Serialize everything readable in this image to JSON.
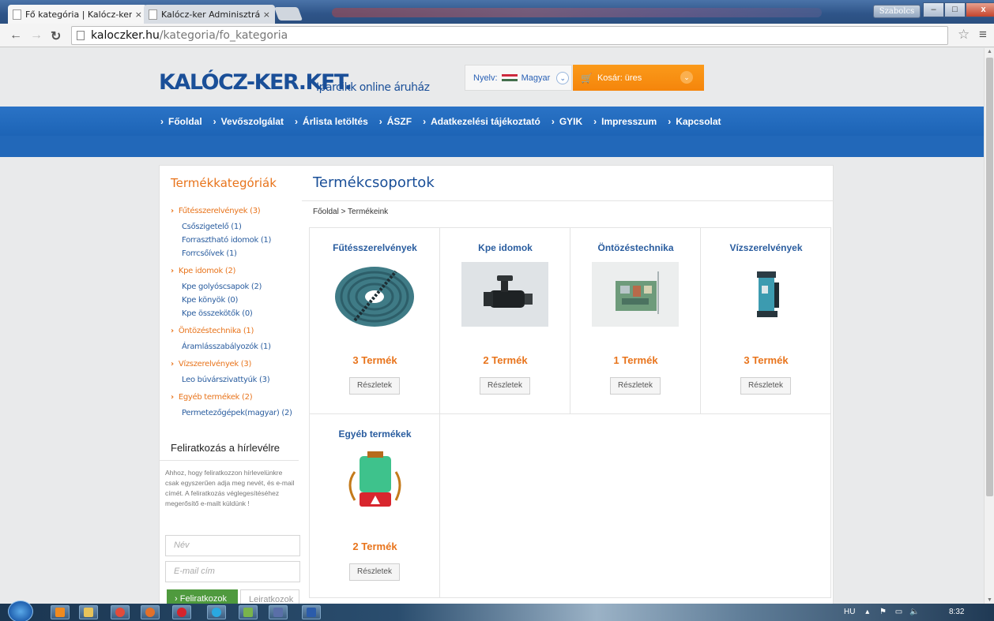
{
  "browser": {
    "tabs": [
      {
        "label": "Fő kategória | Kalócz-ker",
        "close": "×"
      },
      {
        "label": "Kalócz-ker Adminisztráció",
        "close": "×"
      }
    ],
    "user": "Szabolcs",
    "window_buttons": {
      "minimize": "–",
      "maximize": "□",
      "close": "x"
    },
    "url_host": "kaloczker.hu",
    "url_path": "/kategoria/fo_kategoria"
  },
  "header": {
    "logo": "KALÓCZ-KER.KFT.",
    "tagline": "Iparcikk online áruház",
    "language_label": "Nyelv:",
    "language_value": "Magyar",
    "cart_label": "Kosár: üres"
  },
  "nav": {
    "items": [
      "Főoldal",
      "Vevőszolgálat",
      "Árlista letöltés",
      "ÁSZF",
      "Adatkezelési tájékoztató",
      "GYIK",
      "Impresszum",
      "Kapcsolat"
    ]
  },
  "sidebar": {
    "title": "Termékkategóriák",
    "categories": [
      {
        "label": "Fűtésszerelvények (3)",
        "subs": [
          "Csőszigetelő (1)",
          "Forrasztható idomok (1)",
          "Forrcsőívek (1)"
        ]
      },
      {
        "label": "Kpe idomok (2)",
        "subs": [
          "Kpe golyóscsapok (2)",
          "Kpe könyök (0)",
          "Kpe összekötők (0)"
        ]
      },
      {
        "label": "Öntözéstechnika (1)",
        "subs": [
          "Áramlásszabályozók (1)"
        ]
      },
      {
        "label": "Vízszerelvények (3)",
        "subs": [
          "Leo búvárszivattyúk (3)"
        ]
      },
      {
        "label": "Egyéb termékek (2)",
        "subs": [
          "Permetezőgépek(magyar) (2)"
        ]
      }
    ]
  },
  "newsletter": {
    "title": "Feliratkozás a hírlevélre",
    "text": "Ahhoz, hogy feliratkozzon hírlevelünkre csak egyszerűen adja meg nevét, és e-mail címét. A feliratkozás véglegesítéséhez megerősítő e-mailt küldünk !",
    "name_placeholder": "Név",
    "email_placeholder": "E-mail cím",
    "subscribe": "Feliratkozok",
    "unsubscribe": "Leiratkozok"
  },
  "main": {
    "title": "Termékcsoportok",
    "breadcrumb": [
      "Főoldal",
      "Termékeink"
    ],
    "breadcrumb_sep": ">",
    "groups": [
      {
        "name": "Fűtésszerelvények",
        "count": "3 Termék",
        "button": "Részletek",
        "image": "pipe-insulation-coil"
      },
      {
        "name": "Kpe idomok",
        "count": "2 Termék",
        "button": "Részletek",
        "image": "ball-valve"
      },
      {
        "name": "Öntözéstechnika",
        "count": "1 Termék",
        "button": "Részletek",
        "image": "controller-board"
      },
      {
        "name": "Vízszerelvények",
        "count": "3 Termék",
        "button": "Részletek",
        "image": "submersible-pump"
      },
      {
        "name": "Egyéb termékek",
        "count": "2 Termék",
        "button": "Részletek",
        "image": "backpack-sprayer"
      }
    ]
  },
  "taskbar": {
    "language": "HU",
    "time": "8:32"
  },
  "colors": {
    "brand_blue": "#1a4f98",
    "nav_blue": "#2a73c6",
    "accent_orange": "#e8741c",
    "cart_orange": "#f5850b",
    "subscribe_green": "#4f9a3e"
  }
}
